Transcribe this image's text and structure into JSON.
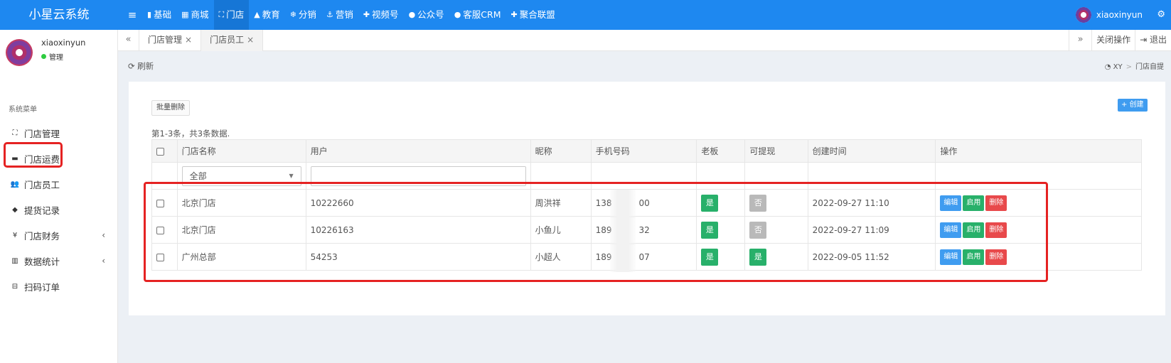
{
  "app": {
    "title": "小星云系统",
    "user": "xiaoxinyun"
  },
  "nav": [
    {
      "label": "基础",
      "icon": "bookmark-icon",
      "glyph": "▮"
    },
    {
      "label": "商城",
      "icon": "shopping-bag-icon",
      "glyph": "▦"
    },
    {
      "label": "门店",
      "icon": "sitemap-icon",
      "glyph": "⛶",
      "active": true
    },
    {
      "label": "教育",
      "icon": "graduation-cap-icon",
      "glyph": "▲"
    },
    {
      "label": "分销",
      "icon": "snowflake-icon",
      "glyph": "❄"
    },
    {
      "label": "营销",
      "icon": "anchor-icon",
      "glyph": "⚓"
    },
    {
      "label": "视频号",
      "icon": "puzzle-icon",
      "glyph": "✚"
    },
    {
      "label": "公众号",
      "icon": "chat-icon",
      "glyph": "●"
    },
    {
      "label": "客服CRM",
      "icon": "comment-icon",
      "glyph": "●"
    },
    {
      "label": "聚合联盟",
      "icon": "puzzle-icon",
      "glyph": "✚"
    }
  ],
  "sidebar": {
    "user": {
      "name": "xiaoxinyun",
      "status": "管理"
    },
    "menu_title": "系统菜单",
    "items": [
      {
        "label": "门店管理",
        "icon": "sitemap-icon",
        "glyph": "⛶"
      },
      {
        "label": "门店运费",
        "icon": "truck-icon",
        "glyph": "▬"
      },
      {
        "label": "门店员工",
        "icon": "users-icon",
        "glyph": "👥"
      },
      {
        "label": "提货记录",
        "icon": "tags-icon",
        "glyph": "◆"
      },
      {
        "label": "门店财务",
        "icon": "yen-icon",
        "glyph": "¥",
        "arrow": "‹"
      },
      {
        "label": "数据统计",
        "icon": "bar-chart-icon",
        "glyph": "▥",
        "arrow": "‹"
      },
      {
        "label": "扫码订单",
        "icon": "minus-square-icon",
        "glyph": "⊟"
      }
    ]
  },
  "tabs": {
    "prev": "«",
    "next": "»",
    "items": [
      {
        "label": "门店管理",
        "close": "×"
      },
      {
        "label": "门店员工",
        "close": "×",
        "active": true
      }
    ],
    "close_ops": "关闭操作",
    "logout": "退出"
  },
  "header": {
    "refresh": "刷新",
    "breadcrumb": [
      "XY",
      "门店自提"
    ]
  },
  "toolbar": {
    "batch_delete": "批量删除",
    "create": "+ 创建"
  },
  "summary": "第1-3条，共3条数据.",
  "table": {
    "columns": [
      "门店名称",
      "用户",
      "昵称",
      "手机号码",
      "老板",
      "可提现",
      "创建时间",
      "操作"
    ],
    "filter": {
      "store_select": "全部",
      "user_input": ""
    },
    "rows": [
      {
        "store": "北京门店",
        "user": "10222660",
        "nickname": "周洪祥",
        "phone": "138",
        "phone_tail": "00",
        "boss": "是",
        "withdraw": "否",
        "created": "2022-09-27 11:10"
      },
      {
        "store": "北京门店",
        "user": "10226163",
        "nickname": "小鱼儿",
        "phone": "189",
        "phone_tail": "32",
        "boss": "是",
        "withdraw": "否",
        "created": "2022-09-27 11:09"
      },
      {
        "store": "广州总部",
        "user": "54253",
        "nickname": "小超人",
        "phone": "189",
        "phone_tail": "07",
        "boss": "是",
        "withdraw": "是",
        "created": "2022-09-05 11:52"
      }
    ],
    "actions": {
      "edit": "编辑",
      "enable": "启用",
      "delete": "删除"
    }
  },
  "colors": {
    "primary": "#1e88f0",
    "success": "#28b06a",
    "danger": "#e8494b",
    "muted": "#b9b9b9",
    "highlight": "#e52222"
  }
}
